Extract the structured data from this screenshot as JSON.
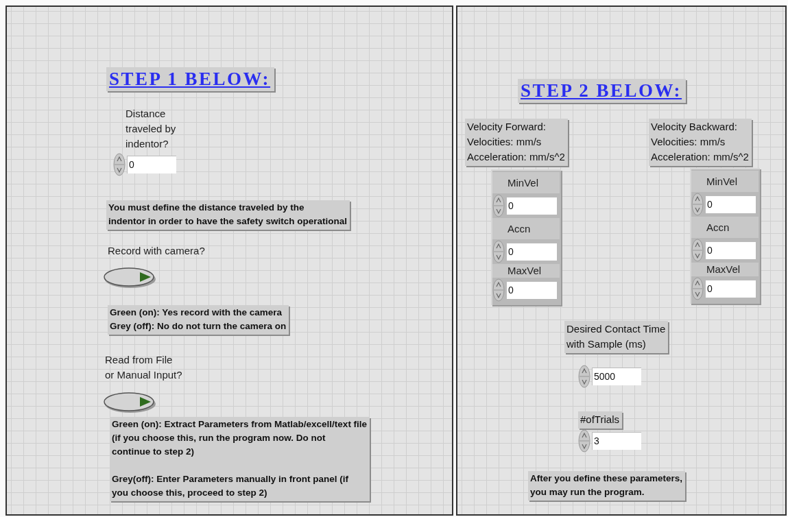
{
  "step1": {
    "heading": "STEP 1 BELOW:",
    "distance": {
      "label": "Distance\ntraveled by\nindentor?",
      "value": "0"
    },
    "distance_note": "You must define the distance traveled by the\nindentor in order to have the safety switch operational",
    "camera": {
      "label": "Record with camera?",
      "on": false
    },
    "camera_note": "Green (on): Yes record with the camera\nGrey (off): No do not turn the camera on",
    "source": {
      "label": "Read from File\nor Manual Input?",
      "on": false
    },
    "source_note": "Green (on): Extract Parameters from Matlab/excell/text file\n(if you choose this, run the program now. Do not\ncontinue to step 2)\n\nGrey(off): Enter Parameters manually in front panel (if\nyou choose this, proceed to step 2)"
  },
  "step2": {
    "heading": "STEP 2 BELOW:",
    "forward": {
      "note": "Velocity Forward:\nVelocities: mm/s\nAcceleration: mm/s^2",
      "fields": [
        {
          "label": "MinVel",
          "value": "0"
        },
        {
          "label": "Accn",
          "value": "0"
        },
        {
          "label": "MaxVel",
          "value": "0"
        }
      ]
    },
    "backward": {
      "note": "Velocity Backward:\nVelocities: mm/s\nAcceleration: mm/s^2",
      "fields": [
        {
          "label": "MinVel",
          "value": "0"
        },
        {
          "label": "Accn",
          "value": "0"
        },
        {
          "label": "MaxVel",
          "value": "0"
        }
      ]
    },
    "contact_time": {
      "label": "Desired Contact Time\nwith Sample (ms)",
      "value": "5000"
    },
    "trials": {
      "label": "#ofTrials",
      "value": "3"
    },
    "final_note": "After you define these parameters,\nyou may run the program."
  }
}
